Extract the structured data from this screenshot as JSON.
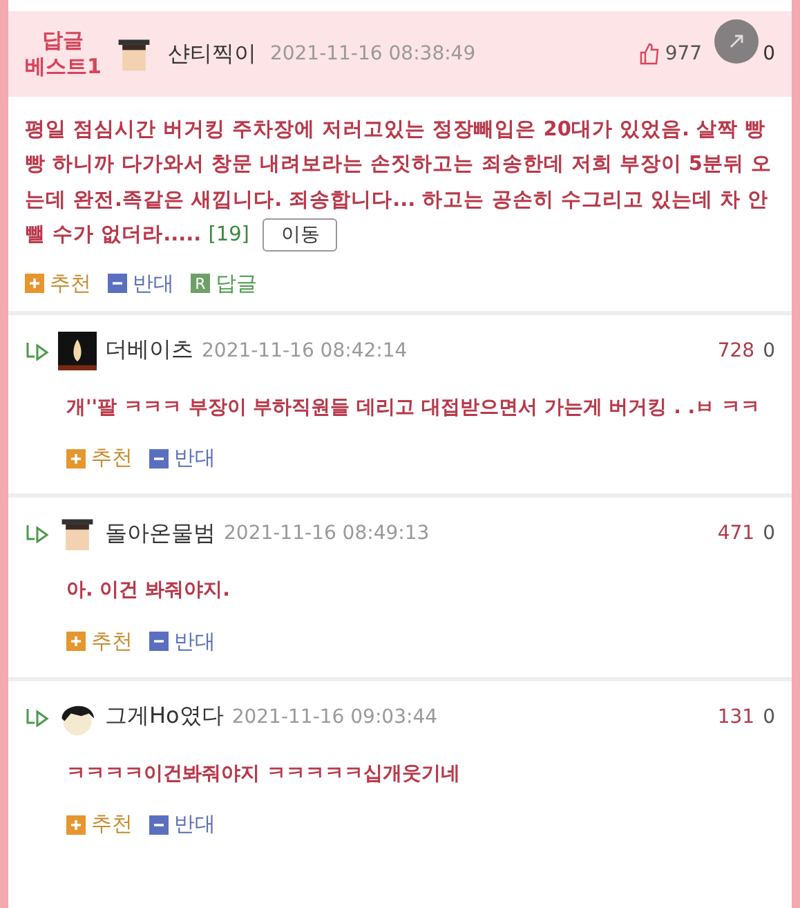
{
  "best_comment": {
    "badge": [
      "답글",
      "베스트1"
    ],
    "author": "샨티찍이",
    "date": "2021-11-16 08:38:49",
    "likes": "977",
    "dislikes": "0",
    "body": "평일 점심시간 버거킹 주차장에 저러고있는 정장빼입은 20대가 있었음. 살짝 빵빵 하니까 다가와서 창문 내려보라는 손짓하고는 죄송한데 저희 부장이 5분뒤 오는데 완전.족같은 새낍니다. 죄송합니다... 하고는 공손히 수그리고 있는데 차 안뺄 수가 없더라.....",
    "reply_count": "[19]",
    "move_button": "이동",
    "actions": [
      {
        "kind": "recommend",
        "label": "추천"
      },
      {
        "kind": "oppose",
        "label": "반대"
      },
      {
        "kind": "reply",
        "label": "답글",
        "icon_label": "R"
      }
    ]
  },
  "replies": [
    {
      "avatar": {
        "kind": "candle"
      },
      "author": "더베이츠",
      "date": "2021-11-16 08:42:14",
      "likes": "728",
      "dislikes": "0",
      "body": "개''팔 ㅋㅋㅋ 부장이 부하직원들 데리고 대접받으면서 가는게 버거킹 . .ㅂ ㅋㅋ",
      "actions": [
        {
          "kind": "recommend",
          "label": "추천"
        },
        {
          "kind": "oppose",
          "label": "반대"
        }
      ]
    },
    {
      "avatar": {
        "kind": "cap"
      },
      "author": "돌아온물범",
      "date": "2021-11-16 08:49:13",
      "likes": "471",
      "dislikes": "0",
      "body": "아. 이건 봐줘야지.",
      "actions": [
        {
          "kind": "recommend",
          "label": "추천"
        },
        {
          "kind": "oppose",
          "label": "반대"
        }
      ]
    },
    {
      "avatar": {
        "kind": "hair"
      },
      "author": "그게Ho였다",
      "date": "2021-11-16 09:03:44",
      "likes": "131",
      "dislikes": "0",
      "body": "ㅋㅋㅋㅋ이건봐줘야지 ㅋㅋㅋㅋㅋ십개웃기네",
      "actions": [
        {
          "kind": "recommend",
          "label": "추천"
        },
        {
          "kind": "oppose",
          "label": "반대"
        }
      ]
    }
  ]
}
